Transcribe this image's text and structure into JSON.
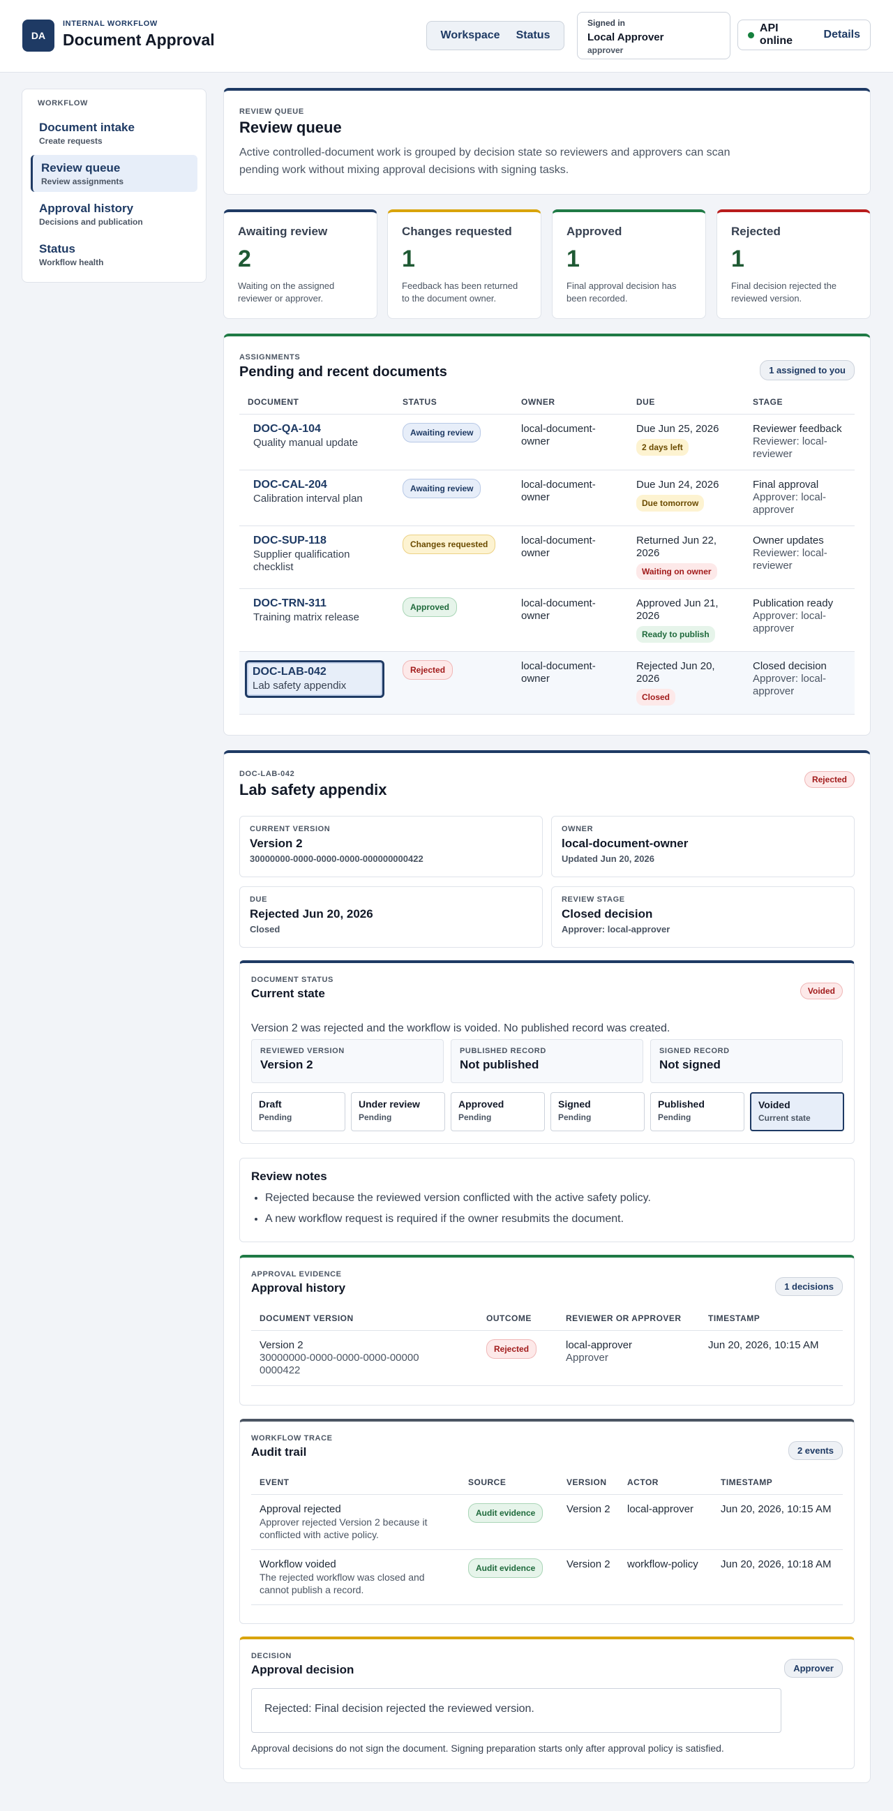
{
  "header": {
    "logo": "DA",
    "eyebrow": "INTERNAL WORKFLOW",
    "title": "Document Approval",
    "nav": [
      "Workspace",
      "Status"
    ],
    "signed_in_label": "Signed in",
    "signed_in_name": "Local Approver",
    "signed_in_role": "approver",
    "api_status": "API online",
    "api_details": "Details"
  },
  "sidebar": {
    "heading": "WORKFLOW",
    "items": [
      {
        "title": "Document intake",
        "sub": "Create requests"
      },
      {
        "title": "Review queue",
        "sub": "Review assignments"
      },
      {
        "title": "Approval history",
        "sub": "Decisions and publication"
      },
      {
        "title": "Status",
        "sub": "Workflow health"
      }
    ]
  },
  "intro": {
    "eyebrow": "REVIEW QUEUE",
    "title": "Review queue",
    "text": "Active controlled-document work is grouped by decision state so reviewers and approvers can scan pending work without mixing approval decisions with signing tasks."
  },
  "stats": [
    {
      "title": "Awaiting review",
      "num": "2",
      "desc": "Waiting on the assigned reviewer or approver."
    },
    {
      "title": "Changes requested",
      "num": "1",
      "desc": "Feedback has been returned to the document owner."
    },
    {
      "title": "Approved",
      "num": "1",
      "desc": "Final approval decision has been recorded."
    },
    {
      "title": "Rejected",
      "num": "1",
      "desc": "Final decision rejected the reviewed version."
    }
  ],
  "assignments": {
    "eyebrow": "ASSIGNMENTS",
    "title": "Pending and recent documents",
    "badge": "1 assigned to you",
    "columns": [
      "DOCUMENT",
      "STATUS",
      "OWNER",
      "DUE",
      "STAGE"
    ],
    "rows": [
      {
        "id": "DOC-QA-104",
        "title": "Quality manual update",
        "status": "Awaiting review",
        "owner": "local-document-owner",
        "due": "Due Jun 25, 2026",
        "due_chip": "2 days left",
        "stage": "Reviewer feedback",
        "stage_sub": "Reviewer: local-reviewer"
      },
      {
        "id": "DOC-CAL-204",
        "title": "Calibration interval plan",
        "status": "Awaiting review",
        "owner": "local-document-owner",
        "due": "Due Jun 24, 2026",
        "due_chip": "Due tomorrow",
        "stage": "Final approval",
        "stage_sub": "Approver: local-approver"
      },
      {
        "id": "DOC-SUP-118",
        "title": "Supplier qualification checklist",
        "status": "Changes requested",
        "owner": "local-document-owner",
        "due": "Returned Jun 22, 2026",
        "due_chip": "Waiting on owner",
        "stage": "Owner updates",
        "stage_sub": "Reviewer: local-reviewer"
      },
      {
        "id": "DOC-TRN-311",
        "title": "Training matrix release",
        "status": "Approved",
        "owner": "local-document-owner",
        "due": "Approved Jun 21, 2026",
        "due_chip": "Ready to publish",
        "stage": "Publication ready",
        "stage_sub": "Approver: local-approver"
      },
      {
        "id": "DOC-LAB-042",
        "title": "Lab safety appendix",
        "status": "Rejected",
        "owner": "local-document-owner",
        "due": "Rejected Jun 20, 2026",
        "due_chip": "Closed",
        "stage": "Closed decision",
        "stage_sub": "Approver: local-approver"
      }
    ]
  },
  "detail": {
    "eyebrow": "DOC-LAB-042",
    "title": "Lab safety appendix",
    "badge": "Rejected",
    "current_version_label": "CURRENT VERSION",
    "current_version": "Version 2",
    "current_version_id": "30000000-0000-0000-0000-000000000422",
    "owner_label": "OWNER",
    "owner": "local-document-owner",
    "owner_updated": "Updated Jun 20, 2026",
    "due_label": "DUE",
    "due": "Rejected Jun 20, 2026",
    "due_sub": "Closed",
    "stage_label": "REVIEW STAGE",
    "stage": "Closed decision",
    "stage_sub": "Approver: local-approver"
  },
  "doc_status": {
    "eyebrow": "DOCUMENT STATUS",
    "title": "Current state",
    "badge": "Voided",
    "text": "Version 2 was rejected and the workflow is voided. No published record was created.",
    "minis": [
      {
        "label": "REVIEWED VERSION",
        "value": "Version 2"
      },
      {
        "label": "PUBLISHED RECORD",
        "value": "Not published"
      },
      {
        "label": "SIGNED RECORD",
        "value": "Not signed"
      }
    ],
    "steps": [
      {
        "t": "Draft",
        "s": "Pending"
      },
      {
        "t": "Under review",
        "s": "Pending"
      },
      {
        "t": "Approved",
        "s": "Pending"
      },
      {
        "t": "Signed",
        "s": "Pending"
      },
      {
        "t": "Published",
        "s": "Pending"
      },
      {
        "t": "Voided",
        "s": "Current state"
      }
    ]
  },
  "notes": {
    "title": "Review notes",
    "items": [
      "Rejected because the reviewed version conflicted with the active safety policy.",
      "A new workflow request is required if the owner resubmits the document."
    ]
  },
  "history": {
    "eyebrow": "APPROVAL EVIDENCE",
    "title": "Approval history",
    "badge": "1 decisions",
    "columns": [
      "DOCUMENT VERSION",
      "OUTCOME",
      "REVIEWER OR APPROVER",
      "TIMESTAMP"
    ],
    "rows": [
      {
        "version": "Version 2",
        "version_id": "30000000-0000-0000-0000-000000000422",
        "outcome": "Rejected",
        "who": "local-approver",
        "role": "Approver",
        "ts": "Jun 20, 2026, 10:15 AM"
      }
    ]
  },
  "audit": {
    "eyebrow": "WORKFLOW TRACE",
    "title": "Audit trail",
    "badge": "2 events",
    "columns": [
      "EVENT",
      "SOURCE",
      "VERSION",
      "ACTOR",
      "TIMESTAMP"
    ],
    "rows": [
      {
        "event": "Approval rejected",
        "desc": "Approver rejected Version 2 because it conflicted with active policy.",
        "source": "Audit evidence",
        "version": "Version 2",
        "actor": "local-approver",
        "ts": "Jun 20, 2026, 10:15 AM"
      },
      {
        "event": "Workflow voided",
        "desc": "The rejected workflow was closed and cannot publish a record.",
        "source": "Audit evidence",
        "version": "Version 2",
        "actor": "workflow-policy",
        "ts": "Jun 20, 2026, 10:18 AM"
      }
    ]
  },
  "decision": {
    "eyebrow": "DECISION",
    "title": "Approval decision",
    "badge": "Approver",
    "box": "Rejected: Final decision rejected the reviewed version.",
    "foot": "Approval decisions do not sign the document. Signing preparation starts only after approval policy is satisfied."
  }
}
